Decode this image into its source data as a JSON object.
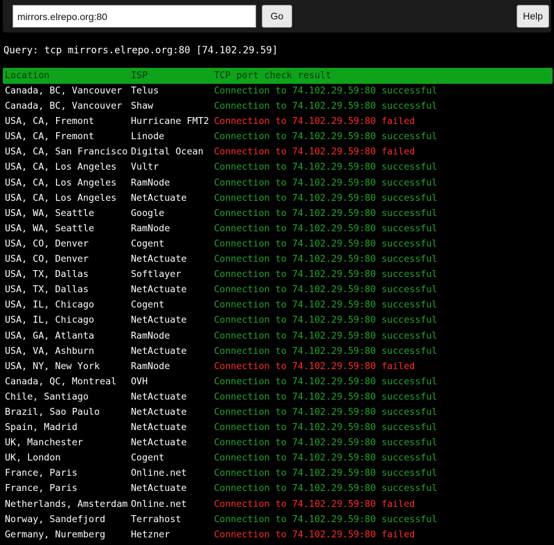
{
  "toolbar": {
    "url_value": "mirrors.elrepo.org:80",
    "go_label": "Go",
    "help_label": "Help"
  },
  "query_text": "Query: tcp mirrors.elrepo.org:80 [74.102.29.59]",
  "colors": {
    "header_bg": "#0fa31c",
    "success": "#22a52c",
    "failed": "#ff2a2a"
  },
  "table": {
    "headers": [
      "Location",
      "ISP",
      "TCP port check result"
    ],
    "rows": [
      {
        "location": "Canada, BC, Vancouver",
        "isp": "Telus",
        "result": "Connection to 74.102.29.59:80 successful",
        "status": "success"
      },
      {
        "location": "Canada, BC, Vancouver",
        "isp": "Shaw",
        "result": "Connection to 74.102.29.59:80 successful",
        "status": "success"
      },
      {
        "location": "USA, CA, Fremont",
        "isp": "Hurricane FMT2",
        "result": "Connection to 74.102.29.59:80 failed",
        "status": "failed"
      },
      {
        "location": "USA, CA, Fremont",
        "isp": "Linode",
        "result": "Connection to 74.102.29.59:80 successful",
        "status": "success"
      },
      {
        "location": "USA, CA, San Francisco",
        "isp": "Digital Ocean",
        "result": "Connection to 74.102.29.59:80 failed",
        "status": "failed"
      },
      {
        "location": "USA, CA, Los Angeles",
        "isp": "Vultr",
        "result": "Connection to 74.102.29.59:80 successful",
        "status": "success"
      },
      {
        "location": "USA, CA, Los Angeles",
        "isp": "RamNode",
        "result": "Connection to 74.102.29.59:80 successful",
        "status": "success"
      },
      {
        "location": "USA, CA, Los Angeles",
        "isp": "NetActuate",
        "result": "Connection to 74.102.29.59:80 successful",
        "status": "success"
      },
      {
        "location": "USA, WA, Seattle",
        "isp": "Google",
        "result": "Connection to 74.102.29.59:80 successful",
        "status": "success"
      },
      {
        "location": "USA, WA, Seattle",
        "isp": "RamNode",
        "result": "Connection to 74.102.29.59:80 successful",
        "status": "success"
      },
      {
        "location": "USA, CO, Denver",
        "isp": "Cogent",
        "result": "Connection to 74.102.29.59:80 successful",
        "status": "success"
      },
      {
        "location": "USA, CO, Denver",
        "isp": "NetActuate",
        "result": "Connection to 74.102.29.59:80 successful",
        "status": "success"
      },
      {
        "location": "USA, TX, Dallas",
        "isp": "Softlayer",
        "result": "Connection to 74.102.29.59:80 successful",
        "status": "success"
      },
      {
        "location": "USA, TX, Dallas",
        "isp": "NetActuate",
        "result": "Connection to 74.102.29.59:80 successful",
        "status": "success"
      },
      {
        "location": "USA, IL, Chicago",
        "isp": "Cogent",
        "result": "Connection to 74.102.29.59:80 successful",
        "status": "success"
      },
      {
        "location": "USA, IL, Chicago",
        "isp": "NetActuate",
        "result": "Connection to 74.102.29.59:80 successful",
        "status": "success"
      },
      {
        "location": "USA, GA, Atlanta",
        "isp": "RamNode",
        "result": "Connection to 74.102.29.59:80 successful",
        "status": "success"
      },
      {
        "location": "USA, VA, Ashburn",
        "isp": "NetActuate",
        "result": "Connection to 74.102.29.59:80 successful",
        "status": "success"
      },
      {
        "location": "USA, NY, New York",
        "isp": "RamNode",
        "result": "Connection to 74.102.29.59:80 failed",
        "status": "failed"
      },
      {
        "location": "Canada, QC, Montreal",
        "isp": "OVH",
        "result": "Connection to 74.102.29.59:80 successful",
        "status": "success"
      },
      {
        "location": "Chile, Santiago",
        "isp": "NetActuate",
        "result": "Connection to 74.102.29.59:80 successful",
        "status": "success"
      },
      {
        "location": "Brazil, Sao Paulo",
        "isp": "NetActuate",
        "result": "Connection to 74.102.29.59:80 successful",
        "status": "success"
      },
      {
        "location": "Spain, Madrid",
        "isp": "NetActuate",
        "result": "Connection to 74.102.29.59:80 successful",
        "status": "success"
      },
      {
        "location": "UK, Manchester",
        "isp": "NetActuate",
        "result": "Connection to 74.102.29.59:80 successful",
        "status": "success"
      },
      {
        "location": "UK, London",
        "isp": "Cogent",
        "result": "Connection to 74.102.29.59:80 successful",
        "status": "success"
      },
      {
        "location": "France, Paris",
        "isp": "Online.net",
        "result": "Connection to 74.102.29.59:80 successful",
        "status": "success"
      },
      {
        "location": "France, Paris",
        "isp": "NetActuate",
        "result": "Connection to 74.102.29.59:80 successful",
        "status": "success"
      },
      {
        "location": "Netherlands, Amsterdam",
        "isp": "Online.net",
        "result": "Connection to 74.102.29.59:80 failed",
        "status": "failed"
      },
      {
        "location": "Norway, Sandefjord",
        "isp": "Terrahost",
        "result": "Connection to 74.102.29.59:80 successful",
        "status": "success"
      },
      {
        "location": "Germany, Nuremberg",
        "isp": "Hetzner",
        "result": "Connection to 74.102.29.59:80 failed",
        "status": "failed"
      }
    ]
  }
}
